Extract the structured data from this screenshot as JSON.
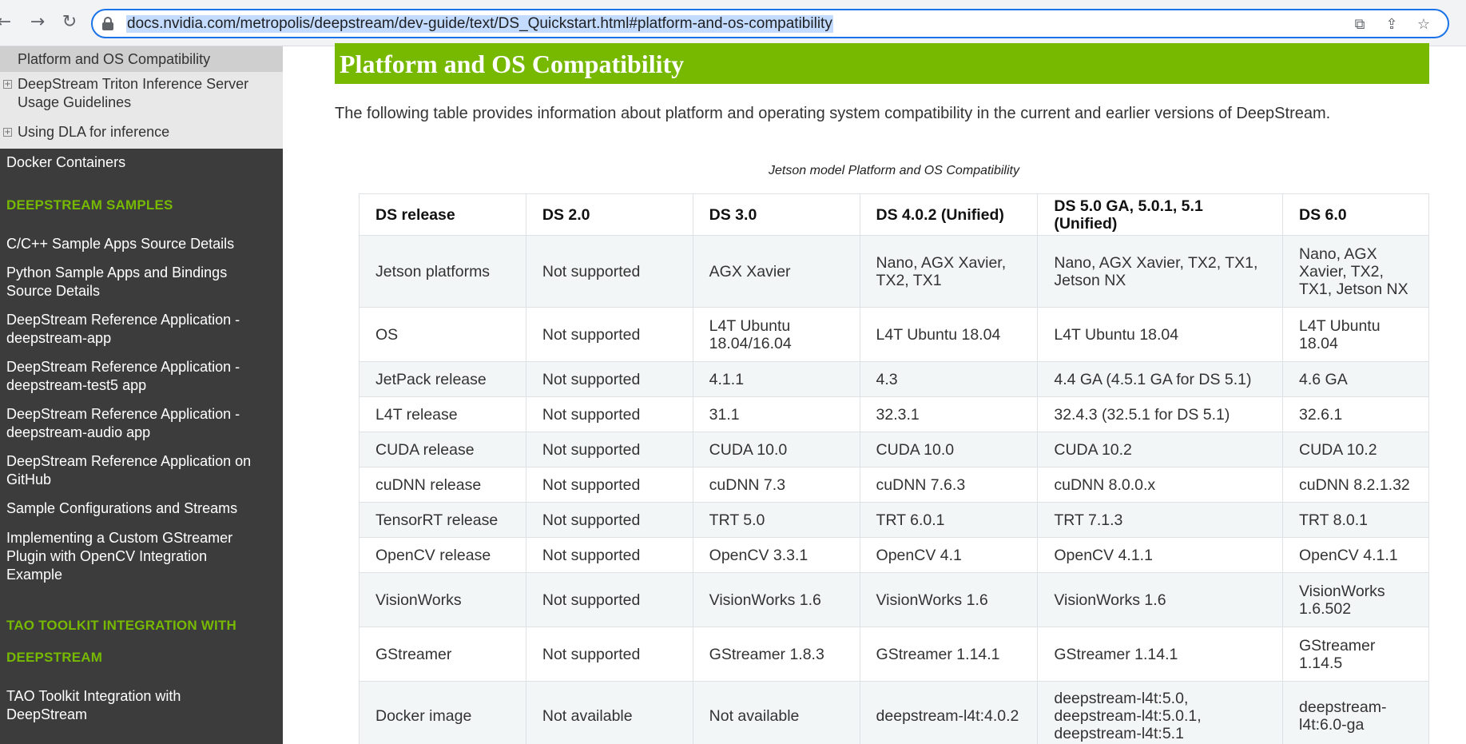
{
  "browser": {
    "url": "docs.nvidia.com/metropolis/deepstream/dev-guide/text/DS_Quickstart.html#platform-and-os-compatibility"
  },
  "sidebar": {
    "light_items": [
      {
        "label": "Platform and OS Compatibility",
        "active": true
      },
      {
        "label": "DeepStream Triton Inference Server Usage Guidelines"
      },
      {
        "label": "Using DLA for inference"
      }
    ],
    "docker_item": "Docker Containers",
    "samples_heading": "DEEPSTREAM SAMPLES",
    "sample_items": [
      "C/C++ Sample Apps Source Details",
      "Python Sample Apps and Bindings Source Details",
      "DeepStream Reference Application - deepstream-app",
      "DeepStream Reference Application - deepstream-test5 app",
      "DeepStream Reference Application - deepstream-audio app",
      "DeepStream Reference Application on GitHub",
      "Sample Configurations and Streams",
      "Implementing a Custom GStreamer Plugin with OpenCV Integration Example"
    ],
    "tao_heading_1": "TAO TOOLKIT INTEGRATION WITH",
    "tao_heading_2": "DEEPSTREAM",
    "tao_item": "TAO Toolkit Integration with DeepStream"
  },
  "main": {
    "title": "Platform and OS Compatibility",
    "intro": "The following table provides information about platform and operating system compatibility in the current and earlier versions of DeepStream.",
    "caption": "Jetson model Platform and OS Compatibility",
    "table": {
      "headers": [
        "DS release",
        "DS 2.0",
        "DS 3.0",
        "DS 4.0.2 (Unified)",
        "DS 5.0 GA, 5.0.1, 5.1 (Unified)",
        "DS 6.0"
      ],
      "rows": [
        [
          "Jetson platforms",
          "Not supported",
          "AGX Xavier",
          "Nano, AGX Xavier, TX2, TX1",
          "Nano, AGX Xavier, TX2, TX1, Jetson NX",
          "Nano, AGX Xavier, TX2, TX1, Jetson NX"
        ],
        [
          "OS",
          "Not supported",
          "L4T Ubuntu 18.04/16.04",
          "L4T Ubuntu 18.04",
          "L4T Ubuntu 18.04",
          "L4T Ubuntu 18.04"
        ],
        [
          "JetPack release",
          "Not supported",
          "4.1.1",
          "4.3",
          "4.4 GA (4.5.1 GA for DS 5.1)",
          "4.6 GA"
        ],
        [
          "L4T release",
          "Not supported",
          "31.1",
          "32.3.1",
          "32.4.3 (32.5.1 for DS 5.1)",
          "32.6.1"
        ],
        [
          "CUDA release",
          "Not supported",
          "CUDA 10.0",
          "CUDA 10.0",
          "CUDA 10.2",
          "CUDA 10.2"
        ],
        [
          "cuDNN release",
          "Not supported",
          "cuDNN 7.3",
          "cuDNN 7.6.3",
          "cuDNN 8.0.0.x",
          "cuDNN 8.2.1.32"
        ],
        [
          "TensorRT release",
          "Not supported",
          "TRT 5.0",
          "TRT 6.0.1",
          "TRT 7.1.3",
          "TRT 8.0.1"
        ],
        [
          "OpenCV release",
          "Not supported",
          "OpenCV 3.3.1",
          "OpenCV 4.1",
          "OpenCV 4.1.1",
          "OpenCV 4.1.1"
        ],
        [
          "VisionWorks",
          "Not supported",
          "VisionWorks 1.6",
          "VisionWorks 1.6",
          "VisionWorks 1.6",
          "VisionWorks 1.6.502"
        ],
        [
          "GStreamer",
          "Not supported",
          "GStreamer 1.8.3",
          "GStreamer 1.14.1",
          "GStreamer 1.14.1",
          "GStreamer 1.14.5"
        ],
        [
          "Docker image",
          "Not available",
          "Not available",
          "deepstream-l4t:4.0.2",
          "deepstream-l4t:5.0, deepstream-l4t:5.0.1, deepstream-l4t:5.1",
          "deepstream-l4t:6.0-ga"
        ]
      ]
    }
  },
  "colors": {
    "accent": "#76b900",
    "sidebar_bg": "#3c3c3c",
    "sidebar_light_bg": "#e8e8e8"
  }
}
